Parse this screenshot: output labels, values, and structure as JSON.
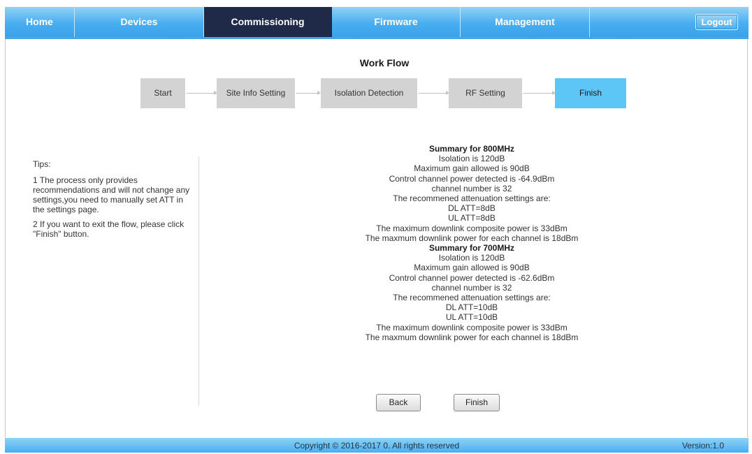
{
  "nav": {
    "items": [
      {
        "label": "Home"
      },
      {
        "label": "Devices"
      },
      {
        "label": "Commissioning"
      },
      {
        "label": "Firmware"
      },
      {
        "label": "Management"
      }
    ],
    "active": "Commissioning",
    "logout_label": "Logout"
  },
  "workflow": {
    "title": "Work Flow",
    "steps": [
      "Start",
      "Site Info Setting",
      "Isolation Detection",
      "RF Setting",
      "Finish"
    ],
    "active_step": "Finish"
  },
  "tips": {
    "title": "Tips:",
    "items": [
      "1 The process only provides recommendations and will not change any settings,you need to manually set ATT in the settings page.",
      "2 If you want to exit the flow, please click \"Finish\" button."
    ]
  },
  "summary": [
    {
      "heading": "Summary for 800MHz",
      "lines": [
        "Isolation is 120dB",
        "Maximum gain allowed is 90dB",
        "Control channel power detected is -64.9dBm",
        "channel number is 32",
        "The recommened attenuation settings are:",
        "DL ATT=8dB",
        "UL ATT=8dB",
        "The maximum downlink composite power is 33dBm",
        "The maxmum downlink power for each channel is 18dBm"
      ]
    },
    {
      "heading": "Summary for 700MHz",
      "lines": [
        "Isolation is 120dB",
        "Maximum gain allowed is 90dB",
        "Control channel power detected is -62.6dBm",
        "channel number is 32",
        "The recommened attenuation settings are:",
        "DL ATT=10dB",
        "UL ATT=10dB",
        "The maximum downlink composite power is 33dBm",
        "The maxmum downlink power for each channel is 18dBm"
      ]
    }
  ],
  "buttons": {
    "back_label": "Back",
    "finish_label": "Finish"
  },
  "footer": {
    "copyright": "Copyright © 2016-2017 0. All rights reserved",
    "version": "Version:1.0"
  },
  "colors": {
    "nav": "#49aef0",
    "nav_active": "#1f2a48",
    "step": "#d3d3d3",
    "step_active": "#5ec6f7"
  }
}
